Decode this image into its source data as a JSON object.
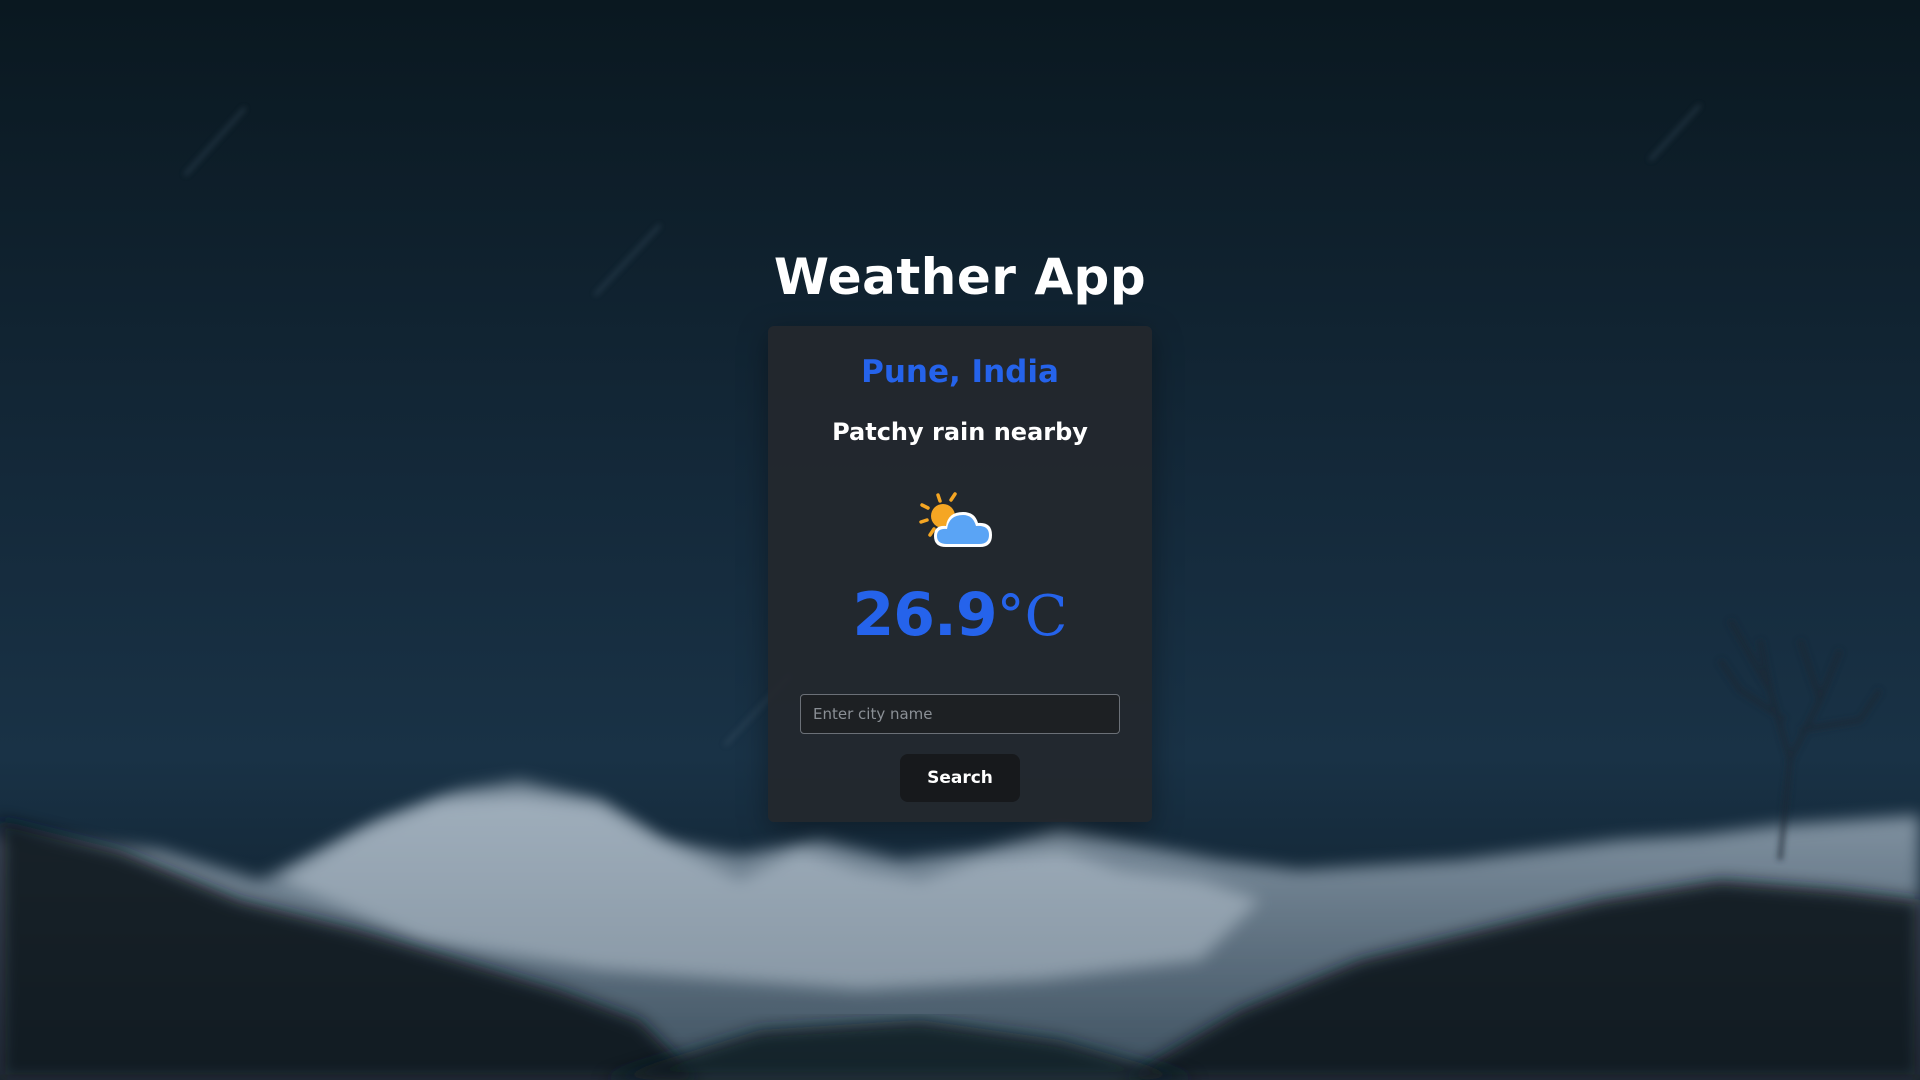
{
  "app": {
    "title": "Weather App"
  },
  "weather": {
    "location": "Pune, India",
    "condition": "Patchy rain nearby",
    "icon": "partly-cloudy-sun-icon",
    "temperature": "26.9",
    "unit": "°C"
  },
  "search": {
    "placeholder": "Enter city name",
    "value": "",
    "button_label": "Search"
  },
  "colors": {
    "accent": "#2563eb",
    "card_background": "#24282d",
    "button_background": "#17191c",
    "sun": "#f5a623",
    "cloud": "#5aa4f5"
  }
}
